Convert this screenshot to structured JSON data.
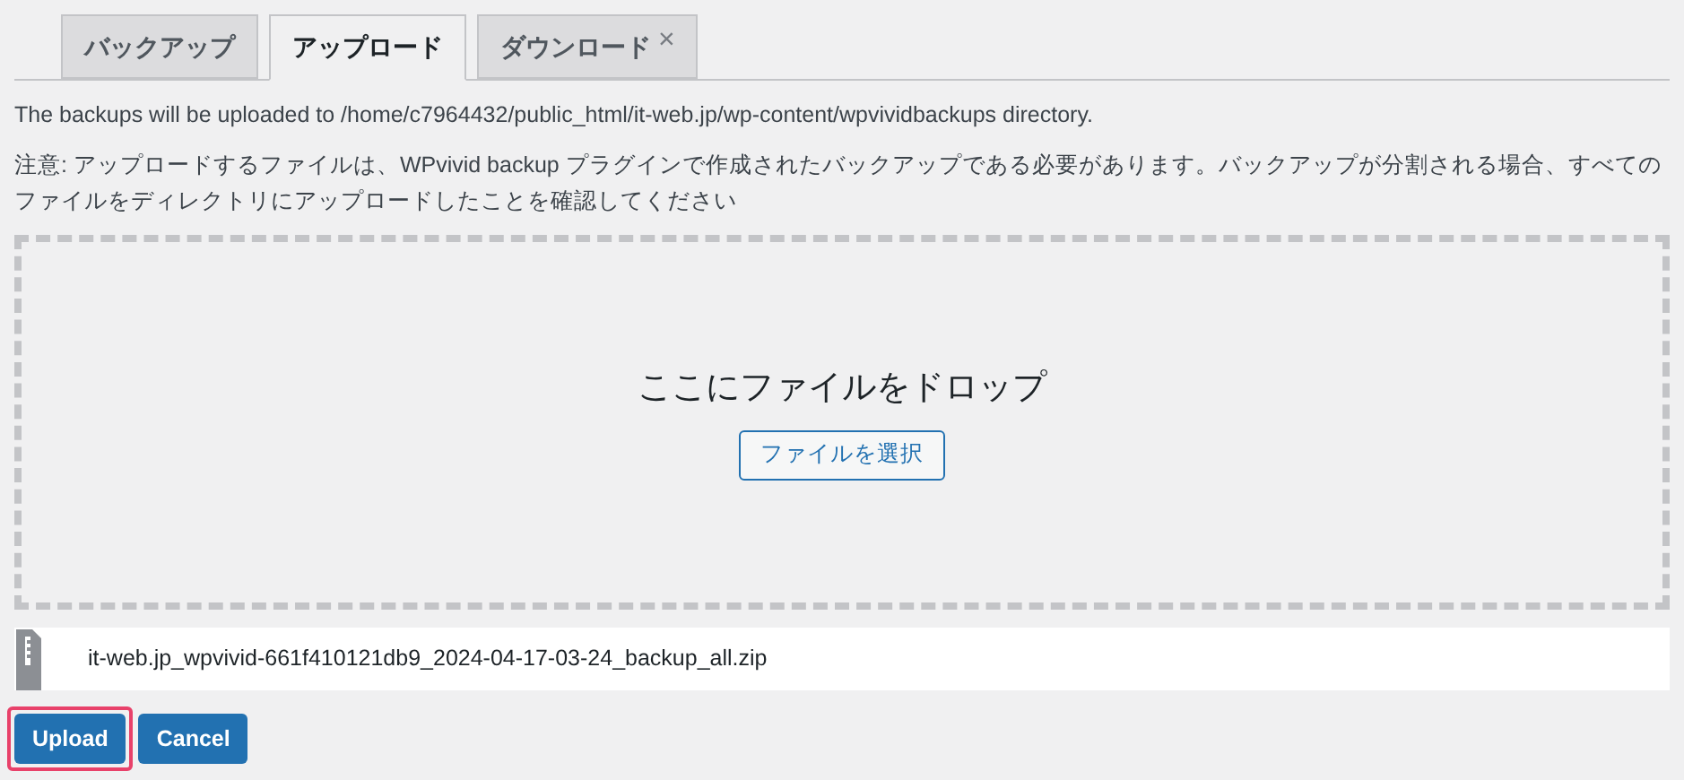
{
  "tabs": [
    {
      "label": "バックアップ",
      "selected": false
    },
    {
      "label": "アップロード",
      "selected": true
    },
    {
      "label": "ダウンロード",
      "selected": false,
      "close": "×"
    }
  ],
  "path_notice": "The backups will be uploaded to /home/c7964432/public_html/it-web.jp/wp-content/wpvividbackups directory.",
  "note": "注意: アップロードするファイルは、WPvivid backup プラグインで作成されたバックアップである必要があります。バックアップが分割される場合、すべてのファイルをディレクトリにアップロードしたことを確認してください",
  "drop_zone": {
    "title": "ここにファイルをドロップ",
    "button": "ファイルを選択"
  },
  "files": [
    {
      "name": "it-web.jp_wpvivid-661f410121db9_2024-04-17-03-24_backup_all.zip"
    }
  ],
  "buttons": [
    {
      "label": "Upload",
      "highlighted": true
    },
    {
      "label": "Cancel",
      "highlighted": false
    }
  ]
}
